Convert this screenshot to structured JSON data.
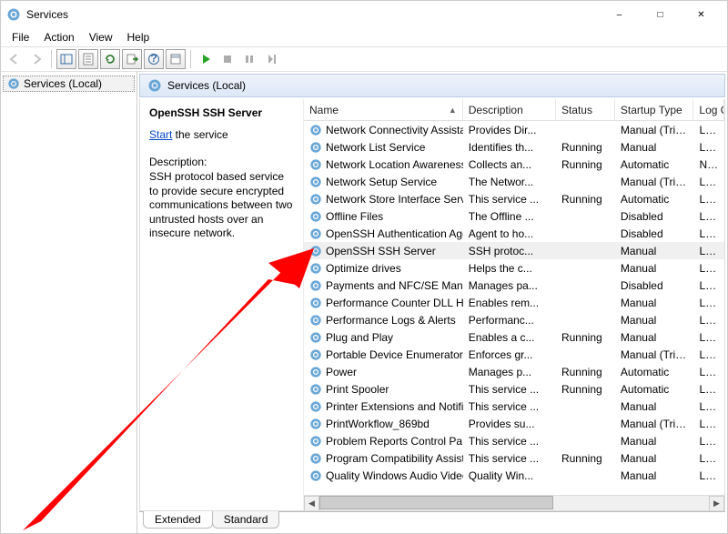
{
  "window": {
    "title": "Services"
  },
  "menu": {
    "file": "File",
    "action": "Action",
    "view": "View",
    "help": "Help"
  },
  "tree": {
    "root": "Services (Local)"
  },
  "pane_header": "Services (Local)",
  "description_panel": {
    "selected_name": "OpenSSH SSH Server",
    "start_link": "Start",
    "start_suffix": " the service",
    "desc_label": "Description:",
    "desc_text": "SSH protocol based service to provide secure encrypted communications between two untrusted hosts over an insecure network."
  },
  "columns": {
    "name": "Name",
    "description": "Description",
    "status": "Status",
    "startup": "Startup Type",
    "logon": "Log On As"
  },
  "tabs": {
    "extended": "Extended",
    "standard": "Standard"
  },
  "services": [
    {
      "name": "Network Connectivity Assistant",
      "desc": "Provides Dir...",
      "status": "",
      "startup": "Manual (Trig...",
      "logon": "Local System"
    },
    {
      "name": "Network List Service",
      "desc": "Identifies th...",
      "status": "Running",
      "startup": "Manual",
      "logon": "Local Service"
    },
    {
      "name": "Network Location Awareness",
      "desc": "Collects an...",
      "status": "Running",
      "startup": "Automatic",
      "logon": "Network Service"
    },
    {
      "name": "Network Setup Service",
      "desc": "The Networ...",
      "status": "",
      "startup": "Manual (Trig...",
      "logon": "Local System"
    },
    {
      "name": "Network Store Interface Service",
      "desc": "This service ...",
      "status": "Running",
      "startup": "Automatic",
      "logon": "Local Service"
    },
    {
      "name": "Offline Files",
      "desc": "The Offline ...",
      "status": "",
      "startup": "Disabled",
      "logon": "Local System"
    },
    {
      "name": "OpenSSH Authentication Agent",
      "desc": "Agent to ho...",
      "status": "",
      "startup": "Disabled",
      "logon": "Local System"
    },
    {
      "name": "OpenSSH SSH Server",
      "desc": "SSH protoc...",
      "status": "",
      "startup": "Manual",
      "logon": "Local System",
      "selected": true
    },
    {
      "name": "Optimize drives",
      "desc": "Helps the c...",
      "status": "",
      "startup": "Manual",
      "logon": "Local System"
    },
    {
      "name": "Payments and NFC/SE Manager",
      "desc": "Manages pa...",
      "status": "",
      "startup": "Disabled",
      "logon": "Local Service"
    },
    {
      "name": "Performance Counter DLL Host",
      "desc": "Enables rem...",
      "status": "",
      "startup": "Manual",
      "logon": "Local Service"
    },
    {
      "name": "Performance Logs & Alerts",
      "desc": "Performanc...",
      "status": "",
      "startup": "Manual",
      "logon": "Local Service"
    },
    {
      "name": "Plug and Play",
      "desc": "Enables a c...",
      "status": "Running",
      "startup": "Manual",
      "logon": "Local System"
    },
    {
      "name": "Portable Device Enumerator Service",
      "desc": "Enforces gr...",
      "status": "",
      "startup": "Manual (Trig...",
      "logon": "Local System"
    },
    {
      "name": "Power",
      "desc": "Manages p...",
      "status": "Running",
      "startup": "Automatic",
      "logon": "Local System"
    },
    {
      "name": "Print Spooler",
      "desc": "This service ...",
      "status": "Running",
      "startup": "Automatic",
      "logon": "Local System"
    },
    {
      "name": "Printer Extensions and Notifications",
      "desc": "This service ...",
      "status": "",
      "startup": "Manual",
      "logon": "Local System"
    },
    {
      "name": "PrintWorkflow_869bd",
      "desc": "Provides su...",
      "status": "",
      "startup": "Manual (Trig...",
      "logon": "Local System"
    },
    {
      "name": "Problem Reports Control Panel Support",
      "desc": "This service ...",
      "status": "",
      "startup": "Manual",
      "logon": "Local System"
    },
    {
      "name": "Program Compatibility Assistant Service",
      "desc": "This service ...",
      "status": "Running",
      "startup": "Manual",
      "logon": "Local System"
    },
    {
      "name": "Quality Windows Audio Video Experience",
      "desc": "Quality Win...",
      "status": "",
      "startup": "Manual",
      "logon": "Local Service"
    }
  ]
}
